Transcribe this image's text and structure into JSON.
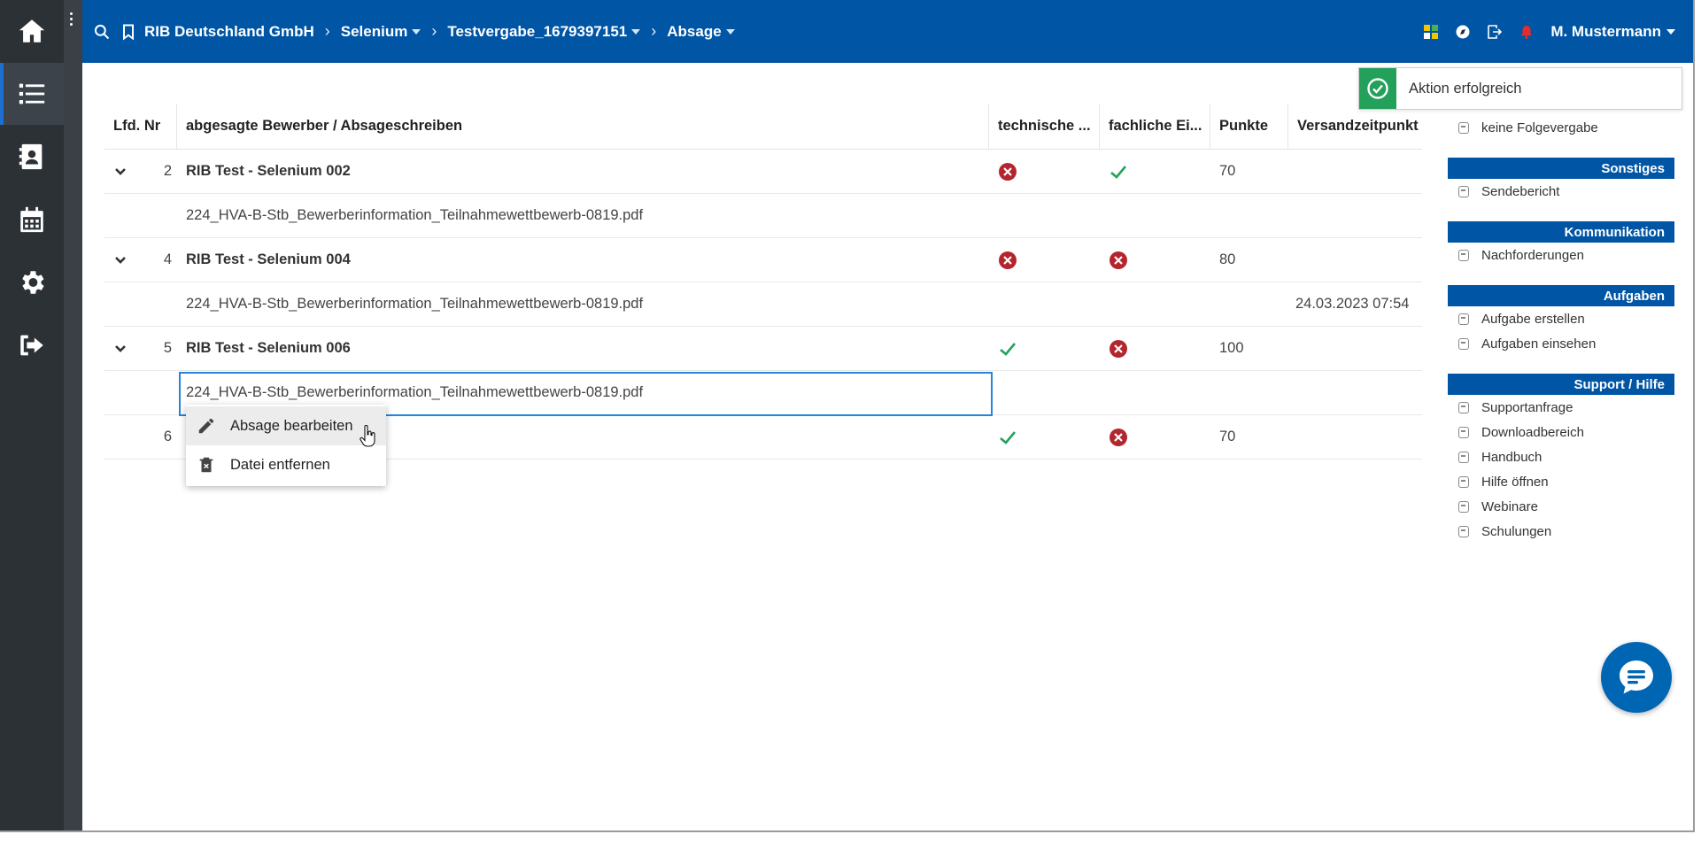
{
  "colors": {
    "brand_blue": "#0055a5",
    "rail_dark": "#2c3136",
    "success_green": "#23a05a",
    "error_red": "#b3262e",
    "selection_blue": "#2684d9"
  },
  "rail": {
    "items": [
      "home-icon",
      "list-icon",
      "contacts-icon",
      "calendar-icon",
      "settings-icon",
      "logout-icon"
    ],
    "active": "list-icon"
  },
  "topbar": {
    "breadcrumbs": [
      {
        "label": "RIB Deutschland GmbH",
        "dropdown": false
      },
      {
        "label": "Selenium",
        "dropdown": true
      },
      {
        "label": "Testvergabe_1679397151",
        "dropdown": true
      },
      {
        "label": "Absage",
        "dropdown": true
      }
    ],
    "user": "M. Mustermann"
  },
  "table": {
    "headers": {
      "nr": "Lfd. Nr",
      "name": "abgesagte Bewerber / Absageschreiben",
      "tech": "technische ...",
      "fach": "fachliche Ei...",
      "punkte": "Punkte",
      "versand": "Versandzeitpunkt"
    },
    "rows": [
      {
        "nr": "2",
        "name": "RIB Test - Selenium 002",
        "tech": "error",
        "fach": "ok",
        "punkte": "70",
        "doc": "224_HVA-B-Stb_Bewerberinformation_Teilnahmewettbewerb-0819.pdf",
        "doc_date": ""
      },
      {
        "nr": "4",
        "name": "RIB Test - Selenium 004",
        "tech": "error",
        "fach": "error",
        "punkte": "80",
        "doc": "224_HVA-B-Stb_Bewerberinformation_Teilnahmewettbewerb-0819.pdf",
        "doc_date": "24.03.2023 07:54"
      },
      {
        "nr": "5",
        "name": "RIB Test - Selenium 006",
        "tech": "ok",
        "fach": "error",
        "punkte": "100",
        "doc": "224_HVA-B-Stb_Bewerberinformation_Teilnahmewettbewerb-0819.pdf",
        "doc_date": ""
      },
      {
        "nr": "6",
        "name": "",
        "tech": "ok",
        "fach": "error",
        "punkte": "70"
      }
    ]
  },
  "context_menu": {
    "items": [
      {
        "label": "Absage bearbeiten",
        "icon": "pencil-icon"
      },
      {
        "label": "Datei entfernen",
        "icon": "trash-icon"
      }
    ]
  },
  "toast": {
    "text": "Aktion erfolgreich",
    "icon": "check-circle-icon"
  },
  "right_panel": {
    "top_link": "keine Folgevergabe",
    "sections": [
      {
        "title": "Sonstiges",
        "links": [
          "Sendebericht"
        ]
      },
      {
        "title": "Kommunikation",
        "links": [
          "Nachforderungen"
        ]
      },
      {
        "title": "Aufgaben",
        "links": [
          "Aufgabe erstellen",
          "Aufgaben einsehen"
        ]
      },
      {
        "title": "Support / Hilfe",
        "links": [
          "Supportanfrage",
          "Downloadbereich",
          "Handbuch",
          "Hilfe öffnen",
          "Webinare",
          "Schulungen"
        ]
      }
    ]
  },
  "chat": {
    "icon": "chat-bubble-icon"
  }
}
